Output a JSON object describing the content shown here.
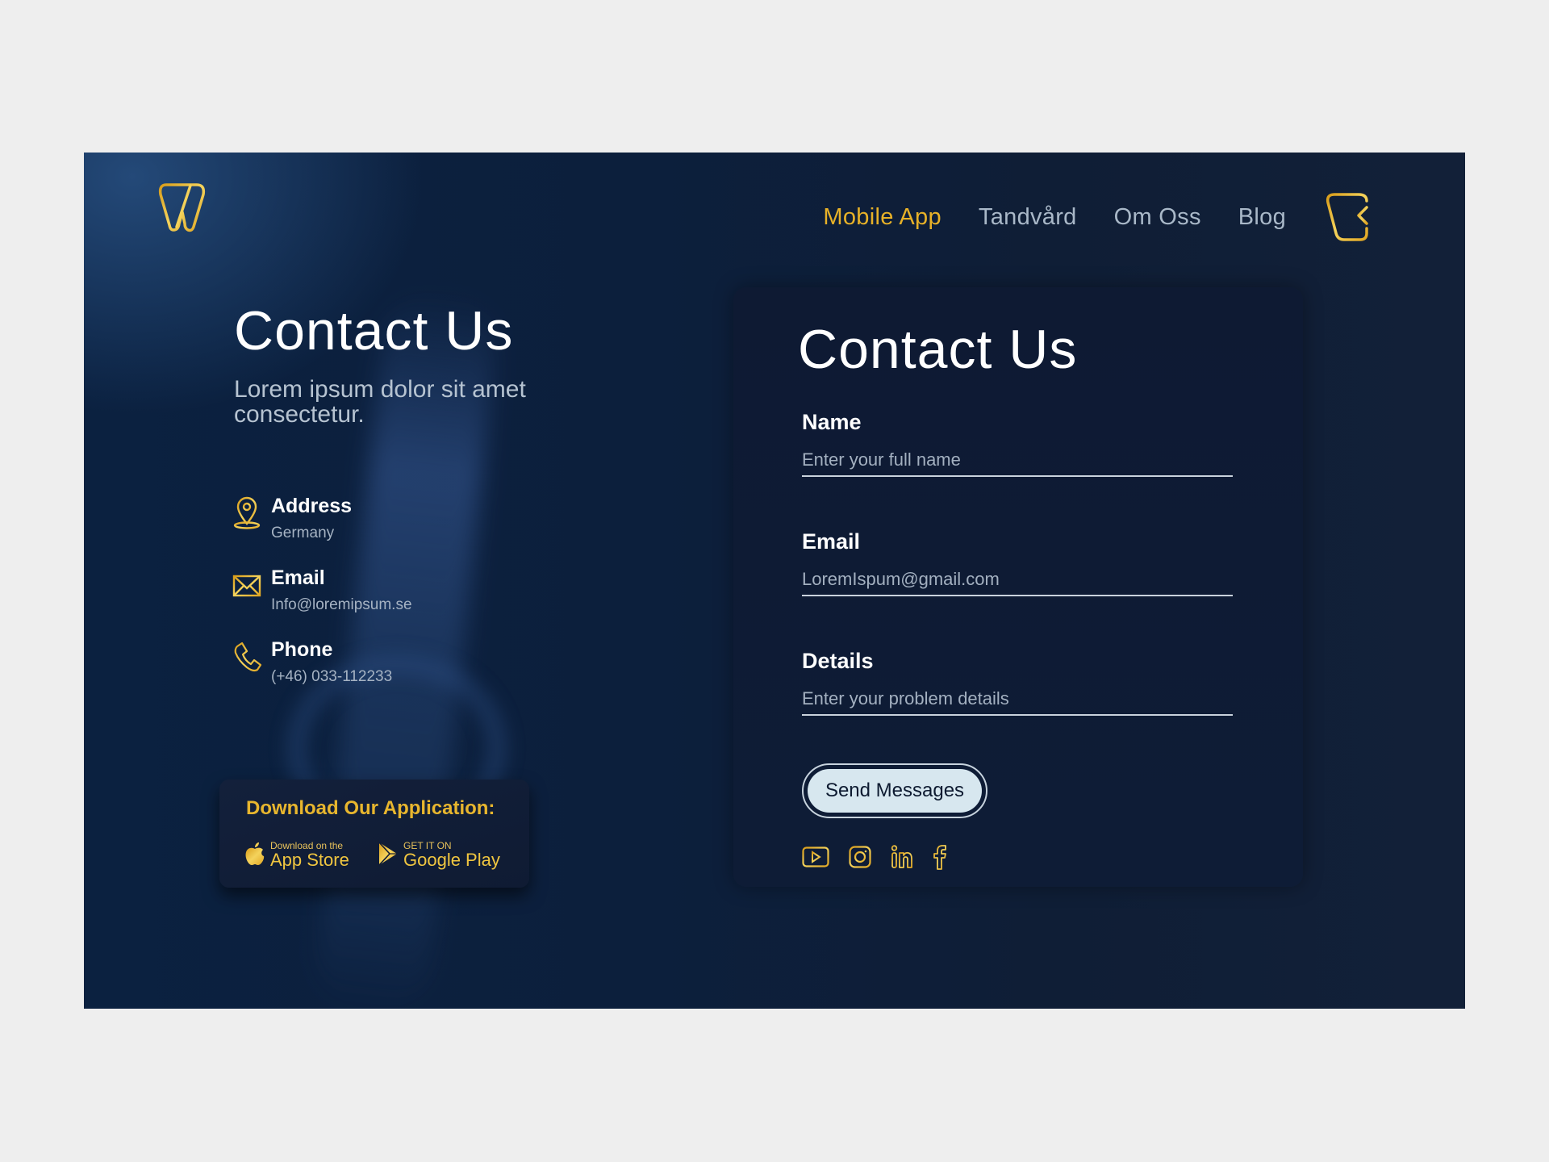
{
  "brand": {
    "logo_icon": "tooth-logo-icon",
    "accent_color": "#e7b128"
  },
  "nav": {
    "items": [
      {
        "label": "Mobile App",
        "active": true
      },
      {
        "label": "Tandvård",
        "active": false
      },
      {
        "label": "Om Oss",
        "active": false
      },
      {
        "label": "Blog",
        "active": false
      }
    ],
    "cart_icon": "tooth-back-icon"
  },
  "intro": {
    "title": "Contact Us",
    "subtitle": "Lorem ipsum dolor sit amet consectetur."
  },
  "contact_info": [
    {
      "icon": "location-pin-icon",
      "title": "Address",
      "value": "Germany"
    },
    {
      "icon": "envelope-icon",
      "title": "Email",
      "value": "Info@loremipsum.se"
    },
    {
      "icon": "phone-icon",
      "title": "Phone",
      "value": "(+46) 033-112233"
    }
  ],
  "download": {
    "title": "Download Our Application:",
    "app_store": {
      "small": "Download on the",
      "big": "App Store"
    },
    "google_play": {
      "small": "GET IT ON",
      "big": "Google Play"
    }
  },
  "form": {
    "title": "Contact Us",
    "fields": [
      {
        "label": "Name",
        "value": "",
        "placeholder": "Enter your full name"
      },
      {
        "label": "Email",
        "value": "",
        "placeholder": "LoremIspum@gmail.com"
      },
      {
        "label": "Details",
        "value": "",
        "placeholder": "Enter your problem details"
      }
    ],
    "submit_label": "Send Messages",
    "socials": [
      "youtube-icon",
      "instagram-icon",
      "linkedin-icon",
      "facebook-icon"
    ]
  }
}
